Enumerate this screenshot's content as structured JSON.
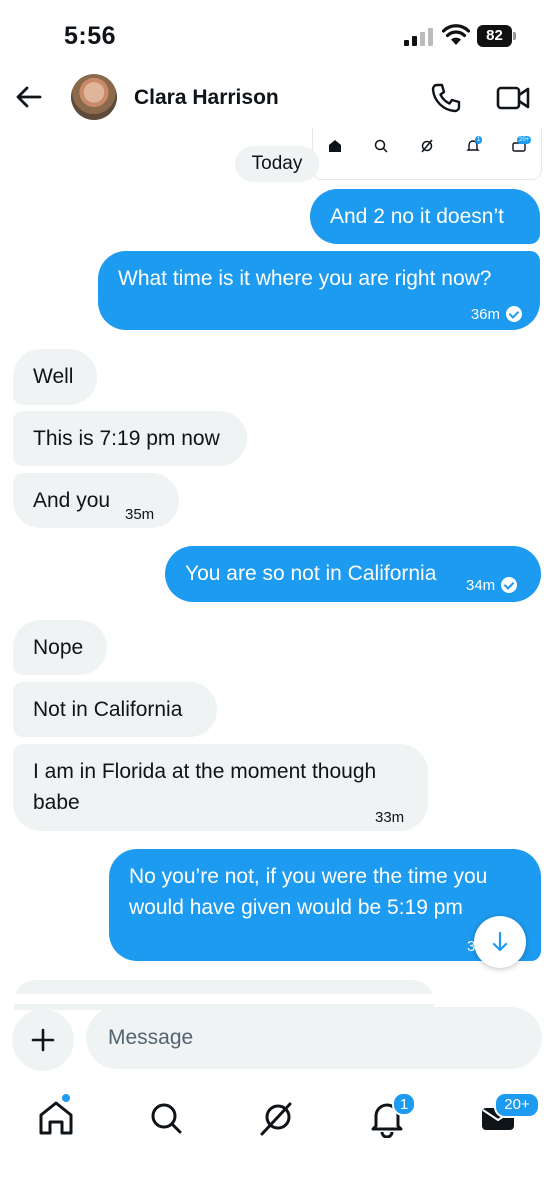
{
  "status_bar": {
    "time": "5:56",
    "battery": "82"
  },
  "header": {
    "contact_name": "Clara Harrison"
  },
  "conversation": {
    "date_label": "Today",
    "messages": [
      {
        "dir": "out",
        "text": "And 2 no it doesn’t"
      },
      {
        "dir": "out",
        "text": "What time is it where you are right now?",
        "time": "36m"
      },
      {
        "dir": "in",
        "text": "Well"
      },
      {
        "dir": "in",
        "text": "This is 7:19 pm now"
      },
      {
        "dir": "in",
        "text": "And you",
        "time": "35m"
      },
      {
        "dir": "out",
        "text": "You are so not in California",
        "time": "34m"
      },
      {
        "dir": "in",
        "text": "Nope"
      },
      {
        "dir": "in",
        "text": "Not in California"
      },
      {
        "dir": "in",
        "text_line1": "I am in Florida at the moment though",
        "text_line2": "babe",
        "time": "33m"
      },
      {
        "dir": "out",
        "text_line1": "No you’re not, if you were the time you",
        "text_line2": "would have given would be 5:19 pm",
        "time_partial": "3"
      }
    ]
  },
  "composer": {
    "placeholder": "Message"
  },
  "tabbar": {
    "notifications_badge": "1",
    "messages_badge": "20+"
  },
  "mini_nav": {
    "notifications_badge": "1",
    "messages_badge": "20+"
  },
  "colors": {
    "accent": "#1d9bf0",
    "incoming": "#eff3f4",
    "text": "#0f1419"
  }
}
